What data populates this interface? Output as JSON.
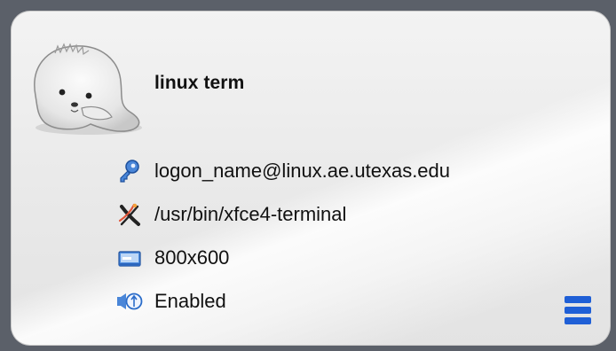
{
  "session": {
    "title": "linux term",
    "host": "logon_name@linux.ae.utexas.edu",
    "command": "/usr/bin/xfce4-terminal",
    "resolution": "800x600",
    "sound": "Enabled"
  },
  "icons": {
    "avatar": "seal-avatar-icon",
    "host": "key-icon",
    "command": "x11-application-icon",
    "resolution": "display-icon",
    "sound": "speaker-icon",
    "menu": "hamburger-menu-icon"
  },
  "colors": {
    "accent": "#1f5fd6",
    "card_background": "#ececec",
    "frame": "#5b6069",
    "text": "#111111"
  }
}
